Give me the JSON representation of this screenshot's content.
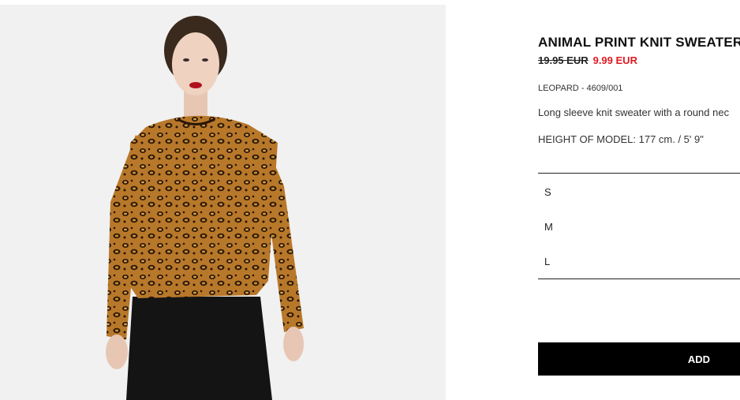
{
  "product": {
    "title": "ANIMAL PRINT KNIT SWEATER",
    "old_price": "19.95 EUR",
    "new_price": "9.99 EUR",
    "color": "LEOPARD",
    "ref_separator": " - ",
    "ref": "4609/001",
    "description": "Long sleeve knit sweater with a round nec",
    "model_height": "HEIGHT OF MODEL: 177 cm. / 5' 9\"",
    "image_alt": "Model wearing leopard print knit sweater and black skirt"
  },
  "sizes": [
    "S",
    "M",
    "L"
  ],
  "actions": {
    "add_label": "ADD"
  },
  "colors": {
    "sale": "#e01a22",
    "button_bg": "#000000",
    "image_bg": "#f1f1f1"
  }
}
